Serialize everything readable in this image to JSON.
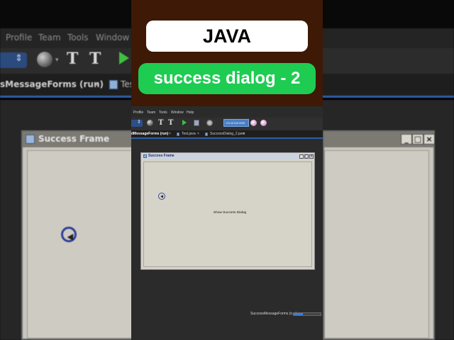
{
  "overlay": {
    "title": "JAVA",
    "subtitle": "success dialog - 2"
  },
  "background": {
    "menus": [
      "Profile",
      "Team",
      "Tools",
      "Window"
    ],
    "tab_active": "sMessageForms (run)",
    "tab_close": "×",
    "tab_second": "Tes",
    "frame_title": "Success Frame",
    "window_buttons": [
      "_",
      "□",
      "×"
    ]
  },
  "ide": {
    "menus": [
      "Profile",
      "Team",
      "Tools",
      "Window",
      "Help"
    ],
    "memory_label": "133.8/168.0MB",
    "tabs": [
      {
        "label": "dMessageForms (run)",
        "close": "×",
        "active": true
      },
      {
        "label": "Test.java",
        "close": "×",
        "active": false
      },
      {
        "label": "SuccessDialog_2.java",
        "close": "×",
        "active": false
      }
    ],
    "status_text": "SuccessMessageForms (run)",
    "progress_fraction": 0.35
  },
  "frame": {
    "title": "Success Frame",
    "buttons": [
      "_",
      "□",
      "×"
    ],
    "show_button_label": "Show Success Dialog"
  },
  "icons": {
    "project-combo": "combo-icon",
    "globe": "globe-icon",
    "build": "hammer-icon",
    "clean-build": "broom-hammer-icon",
    "run": "play-icon",
    "gc": "gc-icon"
  },
  "colors": {
    "overlay_brown": "#3d1906",
    "pill_green": "#1ecc52",
    "ide_dark": "#2b2b2b",
    "tab_underline": "#2d5fa8"
  }
}
